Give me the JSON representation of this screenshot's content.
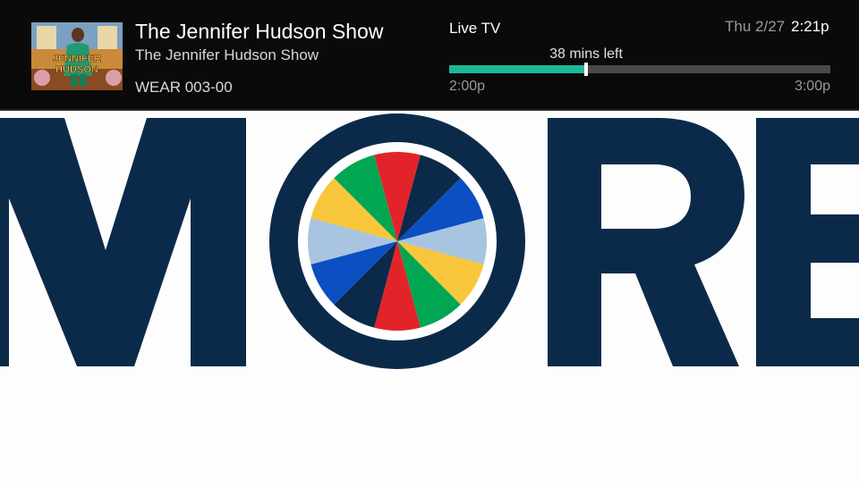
{
  "now_playing": {
    "title": "The Jennifer Hudson Show",
    "episode_title": "The Jennifer Hudson Show",
    "channel": "WEAR 003-00",
    "thumbnail_text_line1": "JENNIFER",
    "thumbnail_text_line2": "HUDSON"
  },
  "status": {
    "source": "Live TV",
    "date": "Thu 2/27",
    "time": "2:21p"
  },
  "progress": {
    "remaining_label": "38 mins left",
    "fraction": 0.36,
    "start_time": "2:00p",
    "end_time": "3:00p",
    "fill_color": "#1fb89a"
  },
  "promo": {
    "word_letters": [
      "M",
      "O",
      "R",
      "E"
    ],
    "letter_color": "#0b2a4a",
    "wheel_colors": [
      "#e3232a",
      "#0b2a4a",
      "#0b4fc3",
      "#a8c4e0",
      "#f7c63b",
      "#00a651",
      "#e3232a",
      "#0b2a4a",
      "#0b4fc3",
      "#a8c4e0",
      "#f7c63b",
      "#00a651"
    ]
  }
}
